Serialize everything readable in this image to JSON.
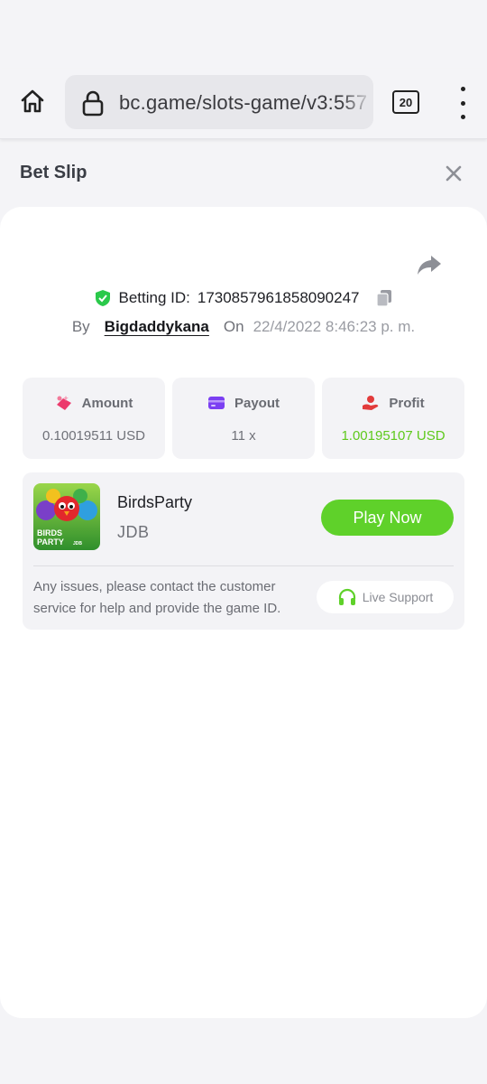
{
  "browser": {
    "url": "bc.game/slots-game/v3:557",
    "tab_count": "20"
  },
  "slip": {
    "title": "Bet Slip"
  },
  "bet": {
    "betting_id_label": "Betting ID:",
    "betting_id": "1730857961858090247",
    "by_label": "By",
    "username": "Bigdaddykana",
    "on_label": "On",
    "date": "22/4/2022 8:46:23 p. m."
  },
  "stats": {
    "amount_label": "Amount",
    "amount_value": "0.10019511 USD",
    "payout_label": "Payout",
    "payout_value": "11 x",
    "profit_label": "Profit",
    "profit_value": "1.00195107 USD"
  },
  "game": {
    "name": "BirdsParty",
    "provider": "JDB",
    "play_label": "Play Now",
    "thumb_text_1": "BIRDS",
    "thumb_text_2": "PARTY",
    "thumb_text_3": "JDB"
  },
  "support": {
    "text": "Any issues, please contact the customer service for help and provide the game ID.",
    "button_label": "Live Support"
  },
  "colors": {
    "accent_green": "#5fd12a",
    "profit_green": "#5ec91c",
    "payout_purple": "#7b3ff2",
    "amount_pink": "#ec3a6c",
    "profit_red": "#e23b3b"
  }
}
